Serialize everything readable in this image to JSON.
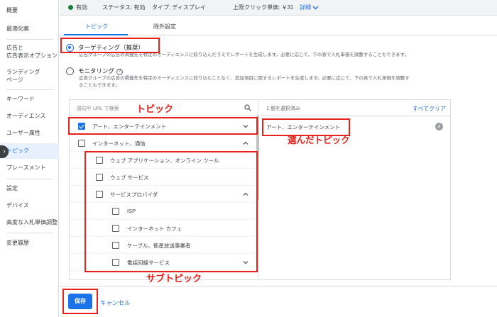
{
  "sidebar": {
    "items": [
      {
        "label": "概要"
      },
      {
        "label": "最適化案"
      },
      {
        "label": "広告と"
      },
      {
        "label": "広告表示オプション"
      },
      {
        "label": "ランディング"
      },
      {
        "label": "ページ"
      },
      {
        "label": "キーワード"
      },
      {
        "label": "オーディエンス"
      },
      {
        "label": "ユーザー属性"
      },
      {
        "label": "トピック"
      },
      {
        "label": "プレースメント"
      },
      {
        "label": "設定"
      },
      {
        "label": "デバイス"
      },
      {
        "label": "高度な入札単価調整"
      },
      {
        "label": "変更履歴"
      }
    ]
  },
  "statusbar": {
    "status": "有効",
    "status_label": "ステータス: 有効",
    "type_label": "タイプ: ディスプレイ",
    "bid_label": "上限クリック単価: ￥31",
    "details_link": "詳細"
  },
  "tabs": [
    {
      "label": "トピック"
    },
    {
      "label": "除外設定"
    }
  ],
  "options": {
    "targeting": {
      "title": "ターゲティング（推奨）",
      "desc": "広告グループの広告の掲載先を特定のオーディエンスに絞り込んだうえでレポートを生成します。必要に応じて、下の表で入札単価を調整することもできます。"
    },
    "monitoring": {
      "title": "モニタリング",
      "desc_line1": "広告グループの広告の掲載先を特定のオーディエンスに絞り込むことなく、追加項目に関するレポートを生成します。必要に応じて、下の表で入札単価を調整す",
      "desc_line2": "ることもできます。"
    }
  },
  "search": {
    "placeholder": "語句や URL で検索"
  },
  "topics": [
    {
      "label": "アート、エンターテインメント",
      "checked": true
    },
    {
      "label": "インターネット、通信",
      "checked": false
    },
    {
      "label": "ウェブ アプリケーション、オンライン ツール",
      "checked": false
    },
    {
      "label": "ウェブ サービス",
      "checked": false
    },
    {
      "label": "サービスプロバイダ",
      "checked": false
    },
    {
      "label": "ISP",
      "checked": false
    },
    {
      "label": "インターネット カフェ",
      "checked": false
    },
    {
      "label": "ケーブル、衛星放送事業者",
      "checked": false
    },
    {
      "label": "電話回線サービス",
      "checked": false
    }
  ],
  "selected": {
    "count": "1 個を選択済み",
    "clear_all": "すべてクリア",
    "items": [
      {
        "label": "アート、エンターテインメント"
      }
    ]
  },
  "footer": {
    "save": "保存",
    "cancel": "キャンセル"
  },
  "annotations": {
    "topic": "トピック",
    "selected_topic": "選んだトピック",
    "subtopic": "サブトピック"
  },
  "colors": {
    "accent": "#1a73e8",
    "annotation": "#e8211c",
    "status": "#188038"
  }
}
